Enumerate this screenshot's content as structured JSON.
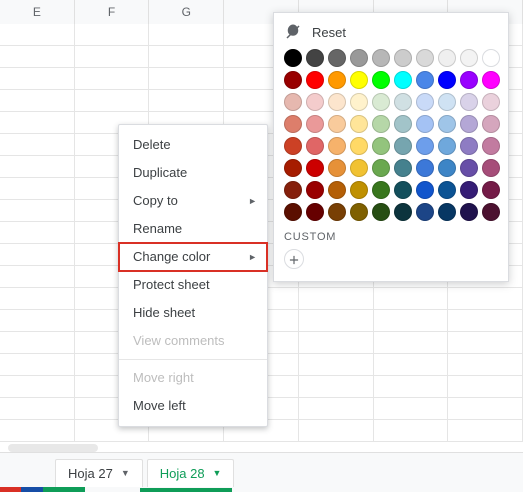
{
  "columns": [
    "E",
    "F",
    "G"
  ],
  "menu": {
    "delete": "Delete",
    "duplicate": "Duplicate",
    "copy_to": "Copy to",
    "rename": "Rename",
    "change_color": "Change color",
    "protect_sheet": "Protect sheet",
    "hide_sheet": "Hide sheet",
    "view_comments": "View comments",
    "move_right": "Move right",
    "move_left": "Move left"
  },
  "palette": {
    "reset_label": "Reset",
    "custom_label": "CUSTOM",
    "colors": [
      [
        "#000000",
        "#434343",
        "#666666",
        "#999999",
        "#b7b7b7",
        "#cccccc",
        "#d9d9d9",
        "#efefef",
        "#f3f3f3",
        "#ffffff"
      ],
      [
        "#980000",
        "#ff0000",
        "#ff9900",
        "#ffff00",
        "#00ff00",
        "#00ffff",
        "#4a86e8",
        "#0000ff",
        "#9900ff",
        "#ff00ff"
      ],
      [
        "#e6b8af",
        "#f4cccc",
        "#fce5cd",
        "#fff2cc",
        "#d9ead3",
        "#d0e0e3",
        "#c9daf8",
        "#cfe2f3",
        "#d9d2e9",
        "#ead1dc"
      ],
      [
        "#dd7e6b",
        "#ea9999",
        "#f9cb9c",
        "#ffe599",
        "#b6d7a8",
        "#a2c4c9",
        "#a4c2f4",
        "#9fc5e8",
        "#b4a7d6",
        "#d5a6bd"
      ],
      [
        "#cc4125",
        "#e06666",
        "#f6b26b",
        "#ffd966",
        "#93c47d",
        "#76a5af",
        "#6d9eeb",
        "#6fa8dc",
        "#8e7cc3",
        "#c27ba0"
      ],
      [
        "#a61c00",
        "#cc0000",
        "#e69138",
        "#f1c232",
        "#6aa84f",
        "#45818e",
        "#3c78d8",
        "#3d85c6",
        "#674ea7",
        "#a64d79"
      ],
      [
        "#85200c",
        "#990000",
        "#b45f06",
        "#bf9000",
        "#38761d",
        "#134f5c",
        "#1155cc",
        "#0b5394",
        "#351c75",
        "#741b47"
      ],
      [
        "#5b0f00",
        "#660000",
        "#783f04",
        "#7f6000",
        "#274e13",
        "#0c343d",
        "#1c4587",
        "#073763",
        "#20124d",
        "#4c1130"
      ]
    ]
  },
  "tabs": {
    "sheet27": "Hoja 27",
    "sheet28": "Hoja 28"
  },
  "accent_colors": {
    "active_tab": "#0f9d58",
    "highlight_box": "#d93025"
  }
}
